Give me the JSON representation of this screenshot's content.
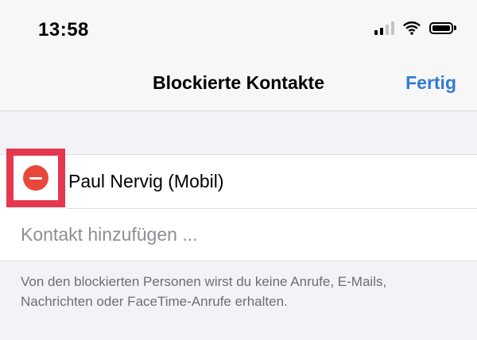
{
  "status_bar": {
    "time": "13:58",
    "icons": [
      "cellular-signal-icon",
      "wifi-icon",
      "battery-icon"
    ]
  },
  "nav": {
    "title": "Blockierte Kontakte",
    "done_label": "Fertig",
    "accent_color": "#2f7bd4"
  },
  "blocked_list": {
    "contacts": [
      {
        "name": "Paul Nervig (Mobil)",
        "remove_icon": "minus-circle-icon"
      }
    ],
    "add_contact_label": "Kontakt hinzufügen ...",
    "highlight_color": "#e5384f",
    "delete_color": "#e8483a"
  },
  "footer": {
    "note": "Von den blockierten Personen wirst du keine Anrufe, E-Mails, Nachrichten oder FaceTime-Anrufe erhalten."
  }
}
